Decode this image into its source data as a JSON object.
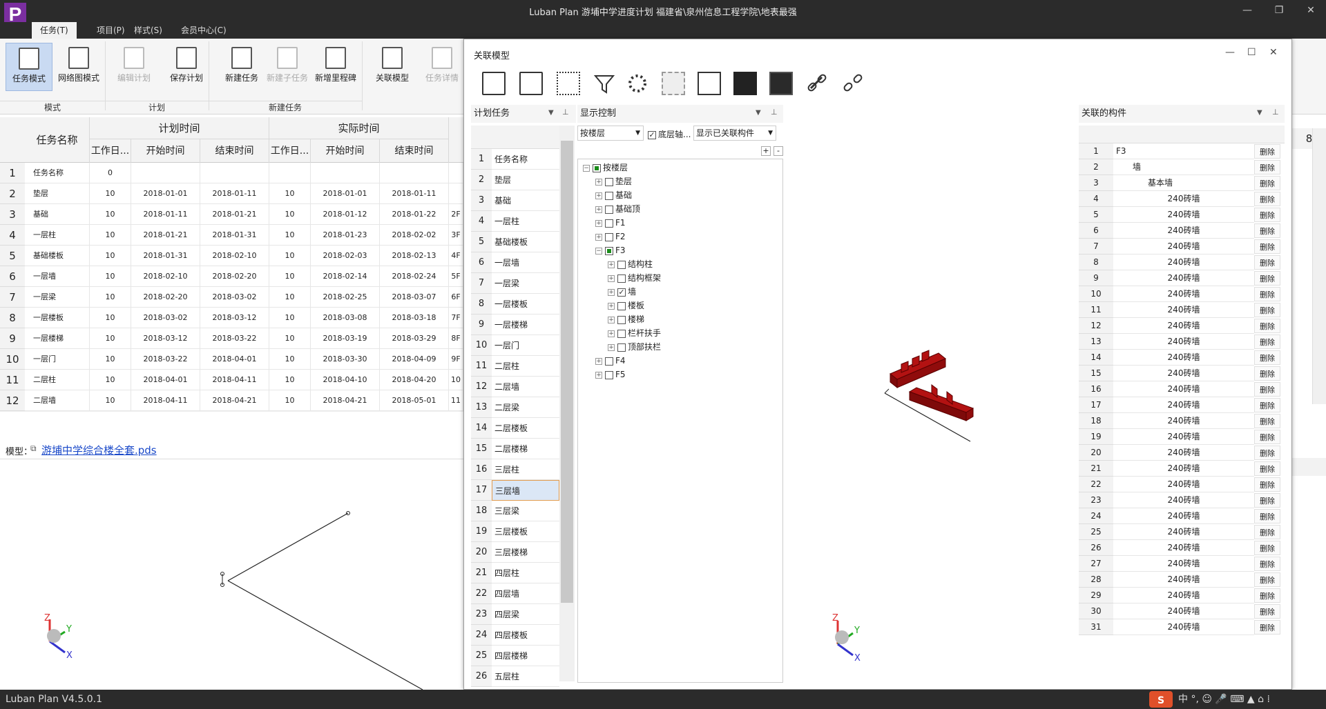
{
  "app": {
    "title": "Luban Plan 游埔中学进度计划 福建省\\泉州信息工程学院\\地表最强",
    "logo": "P",
    "version": "Luban Plan V4.5.0.1"
  },
  "menu": [
    {
      "label": "任务(T)",
      "active": true
    },
    {
      "label": "项目(P)"
    },
    {
      "label": "样式(S)"
    },
    {
      "label": "会员中心(C)"
    }
  ],
  "ribbon": {
    "buttons": [
      {
        "label": "任务模式",
        "icon": "task-mode-icon",
        "selected": true
      },
      {
        "label": "网络图模式",
        "icon": "network-diagram-icon"
      },
      {
        "label": "编辑计划",
        "icon": "edit-plan-icon",
        "disabled": true
      },
      {
        "label": "保存计划",
        "icon": "save-plan-icon"
      },
      {
        "label": "新建任务",
        "icon": "new-task-icon"
      },
      {
        "label": "新建子任务",
        "icon": "new-subtask-icon",
        "disabled": true
      },
      {
        "label": "新增里程碑",
        "icon": "milestone-icon"
      },
      {
        "label": "关联模型",
        "icon": "link-model-icon"
      },
      {
        "label": "任务详情",
        "icon": "task-detail-icon",
        "disabled": true
      }
    ],
    "groups": [
      "模式",
      "计划",
      "新建任务"
    ]
  },
  "main_table": {
    "col_task": "任务名称",
    "plan_group": "计划时间",
    "actual_group": "实际时间",
    "cols": [
      "工作日...",
      "开始时间",
      "结束时间",
      "工作日...",
      "开始时间",
      "结束时间"
    ],
    "rows": [
      {
        "n": "1",
        "name": "任务名称",
        "wd": "0",
        "ps": "",
        "pe": "",
        "awd": "",
        "as": "",
        "ae": "",
        "extra": ""
      },
      {
        "n": "2",
        "name": "垫层",
        "wd": "10",
        "ps": "2018-01-01",
        "pe": "2018-01-11",
        "awd": "10",
        "as": "2018-01-01",
        "ae": "2018-01-11",
        "extra": ""
      },
      {
        "n": "3",
        "name": "基础",
        "wd": "10",
        "ps": "2018-01-11",
        "pe": "2018-01-21",
        "awd": "10",
        "as": "2018-01-12",
        "ae": "2018-01-22",
        "extra": "2F"
      },
      {
        "n": "4",
        "name": "一层柱",
        "wd": "10",
        "ps": "2018-01-21",
        "pe": "2018-01-31",
        "awd": "10",
        "as": "2018-01-23",
        "ae": "2018-02-02",
        "extra": "3F"
      },
      {
        "n": "5",
        "name": "基础楼板",
        "wd": "10",
        "ps": "2018-01-31",
        "pe": "2018-02-10",
        "awd": "10",
        "as": "2018-02-03",
        "ae": "2018-02-13",
        "extra": "4F"
      },
      {
        "n": "6",
        "name": "一层墙",
        "wd": "10",
        "ps": "2018-02-10",
        "pe": "2018-02-20",
        "awd": "10",
        "as": "2018-02-14",
        "ae": "2018-02-24",
        "extra": "5F"
      },
      {
        "n": "7",
        "name": "一层梁",
        "wd": "10",
        "ps": "2018-02-20",
        "pe": "2018-03-02",
        "awd": "10",
        "as": "2018-02-25",
        "ae": "2018-03-07",
        "extra": "6F"
      },
      {
        "n": "8",
        "name": "一层楼板",
        "wd": "10",
        "ps": "2018-03-02",
        "pe": "2018-03-12",
        "awd": "10",
        "as": "2018-03-08",
        "ae": "2018-03-18",
        "extra": "7F"
      },
      {
        "n": "9",
        "name": "一层楼梯",
        "wd": "10",
        "ps": "2018-03-12",
        "pe": "2018-03-22",
        "awd": "10",
        "as": "2018-03-19",
        "ae": "2018-03-29",
        "extra": "8F"
      },
      {
        "n": "10",
        "name": "一层门",
        "wd": "10",
        "ps": "2018-03-22",
        "pe": "2018-04-01",
        "awd": "10",
        "as": "2018-03-30",
        "ae": "2018-04-09",
        "extra": "9F"
      },
      {
        "n": "11",
        "name": "二层柱",
        "wd": "10",
        "ps": "2018-04-01",
        "pe": "2018-04-11",
        "awd": "10",
        "as": "2018-04-10",
        "ae": "2018-04-20",
        "extra": "10"
      },
      {
        "n": "12",
        "name": "二层墙",
        "wd": "10",
        "ps": "2018-04-11",
        "pe": "2018-04-21",
        "awd": "10",
        "as": "2018-04-21",
        "ae": "2018-05-01",
        "extra": "11"
      }
    ]
  },
  "model_bar": {
    "label": "模型：",
    "file": "游埔中学综合楼全套.pds"
  },
  "dialog": {
    "title": "关联模型",
    "plan_panel": {
      "title": "计划任务",
      "rows": [
        "任务名称",
        "垫层",
        "基础",
        "一层柱",
        "基础楼板",
        "一层墙",
        "一层梁",
        "一层楼板",
        "一层楼梯",
        "一层门",
        "二层柱",
        "二层墙",
        "二层梁",
        "二层楼板",
        "二层楼梯",
        "三层柱",
        "三层墙",
        "三层梁",
        "三层楼板",
        "三层楼梯",
        "四层柱",
        "四层墙",
        "四层梁",
        "四层楼板",
        "四层楼梯",
        "五层柱"
      ],
      "selected_index": 16
    },
    "display_panel": {
      "title": "显示控制",
      "mode": "按楼层",
      "bottom_axis": "底层轴...",
      "filter": "显示已关联构件",
      "tree": [
        {
          "label": "按楼层",
          "level": 0,
          "state": "partial"
        },
        {
          "label": "垫层",
          "level": 1
        },
        {
          "label": "基础",
          "level": 1
        },
        {
          "label": "基础顶",
          "level": 1
        },
        {
          "label": "F1",
          "level": 1
        },
        {
          "label": "F2",
          "level": 1
        },
        {
          "label": "F3",
          "level": 1,
          "state": "partial",
          "expanded": true
        },
        {
          "label": "结构柱",
          "level": 2
        },
        {
          "label": "结构框架",
          "level": 2
        },
        {
          "label": "墙",
          "level": 2,
          "state": "checked"
        },
        {
          "label": "楼板",
          "level": 2
        },
        {
          "label": "楼梯",
          "level": 2
        },
        {
          "label": "栏杆扶手",
          "level": 2
        },
        {
          "label": "顶部扶栏",
          "level": 2
        },
        {
          "label": "F4",
          "level": 1
        },
        {
          "label": "F5",
          "level": 1
        }
      ]
    },
    "linked_panel": {
      "title": "关联的构件",
      "delete_label": "删除",
      "rows": [
        {
          "n": "1",
          "name": "F3",
          "indent": 0
        },
        {
          "n": "2",
          "name": "墙",
          "indent": 1
        },
        {
          "n": "3",
          "name": "基本墙",
          "indent": 2
        },
        {
          "n": "4",
          "name": "240砖墙",
          "indent": 3
        },
        {
          "n": "5",
          "name": "240砖墙",
          "indent": 3
        },
        {
          "n": "6",
          "name": "240砖墙",
          "indent": 3
        },
        {
          "n": "7",
          "name": "240砖墙",
          "indent": 3
        },
        {
          "n": "8",
          "name": "240砖墙",
          "indent": 3
        },
        {
          "n": "9",
          "name": "240砖墙",
          "indent": 3
        },
        {
          "n": "10",
          "name": "240砖墙",
          "indent": 3
        },
        {
          "n": "11",
          "name": "240砖墙",
          "indent": 3
        },
        {
          "n": "12",
          "name": "240砖墙",
          "indent": 3
        },
        {
          "n": "13",
          "name": "240砖墙",
          "indent": 3
        },
        {
          "n": "14",
          "name": "240砖墙",
          "indent": 3
        },
        {
          "n": "15",
          "name": "240砖墙",
          "indent": 3
        },
        {
          "n": "16",
          "name": "240砖墙",
          "indent": 3
        },
        {
          "n": "17",
          "name": "240砖墙",
          "indent": 3
        },
        {
          "n": "18",
          "name": "240砖墙",
          "indent": 3
        },
        {
          "n": "19",
          "name": "240砖墙",
          "indent": 3
        },
        {
          "n": "20",
          "name": "240砖墙",
          "indent": 3
        },
        {
          "n": "21",
          "name": "240砖墙",
          "indent": 3
        },
        {
          "n": "22",
          "name": "240砖墙",
          "indent": 3
        },
        {
          "n": "23",
          "name": "240砖墙",
          "indent": 3
        },
        {
          "n": "24",
          "name": "240砖墙",
          "indent": 3
        },
        {
          "n": "25",
          "name": "240砖墙",
          "indent": 3
        },
        {
          "n": "26",
          "name": "240砖墙",
          "indent": 3
        },
        {
          "n": "27",
          "name": "240砖墙",
          "indent": 3
        },
        {
          "n": "28",
          "name": "240砖墙",
          "indent": 3
        },
        {
          "n": "29",
          "name": "240砖墙",
          "indent": 3
        },
        {
          "n": "30",
          "name": "240砖墙",
          "indent": 3
        },
        {
          "n": "31",
          "name": "240砖墙",
          "indent": 3
        }
      ]
    }
  },
  "axis": {
    "x": "X",
    "y": "Y",
    "z": "Z"
  },
  "right_edge": {
    "value": "8"
  },
  "colors": {
    "titlebar": "#2b2b2b",
    "accent": "#7b2fa0",
    "model_red": "#b31212",
    "selection": "#dbe7f6"
  }
}
